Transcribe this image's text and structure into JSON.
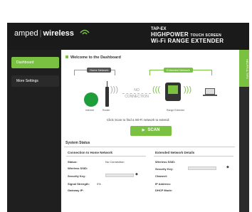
{
  "header": {
    "brand_left": "amped",
    "brand_right": "wireless",
    "product_line1": "TAP-EX",
    "product_line2_big": "HIGHPOWER",
    "product_line2_small": "TOUCH SCREEN",
    "product_line3": "Wi-Fi RANGE EXTENDER"
  },
  "sidebar": {
    "items": [
      {
        "label": "Dashboard"
      },
      {
        "label": "More Settings"
      }
    ]
  },
  "side_tab": {
    "label": "HELPFUL TIPS"
  },
  "main": {
    "welcome": "Welcome to the Dashboard",
    "home_network_label": "Home Network",
    "extended_network_label": "Extended Network",
    "no_connection_1": "NO",
    "no_connection_2": "CONNECTION",
    "caption_internet": "Internet",
    "caption_router": "Router",
    "caption_range": "Range Extender",
    "click_text": "Click Scan to find a Wi-Fi network to extend:",
    "scan_button": "SCAN"
  },
  "status": {
    "title": "System Status",
    "home": {
      "heading": "Connection to Home Network",
      "status_label": "Status:",
      "status_value": "No Connection",
      "ssid_label": "Wireless SSID:",
      "key_label": "Security Key:",
      "signal_label": "Signal Strength:",
      "signal_value": "0%",
      "gateway_label": "Gateway IP:"
    },
    "extended": {
      "heading": "Extended Network Details",
      "ssid_label": "Wireless SSID:",
      "key_label": "Security Key:",
      "channel_label": "Channel:",
      "ip_label": "IP Address:",
      "dhcp_label": "DHCP Mode:"
    }
  },
  "colors": {
    "accent": "#7ac142",
    "header_bg": "#1a1a1a",
    "sidebar_bg": "#1f1f1f"
  }
}
